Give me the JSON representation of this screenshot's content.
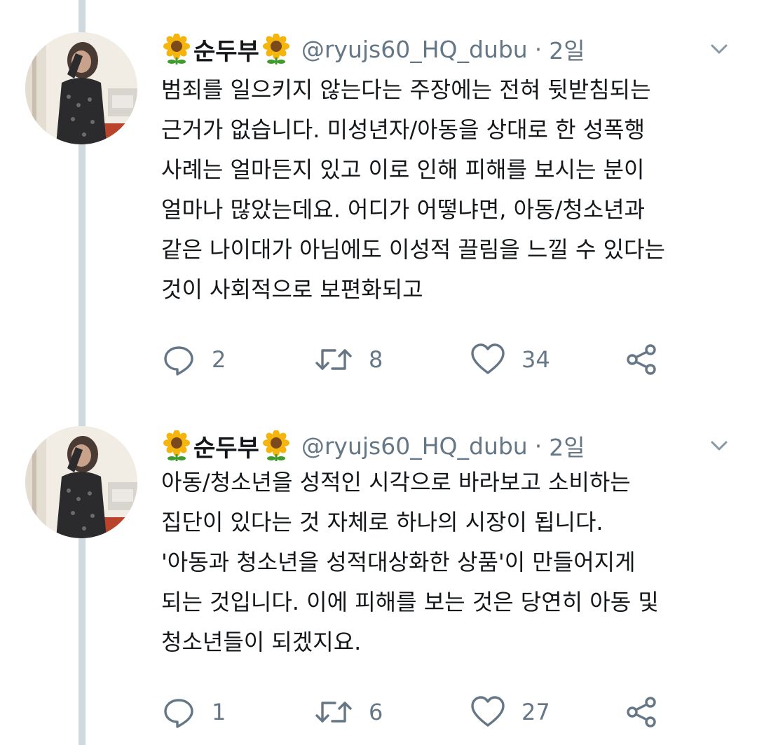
{
  "colors": {
    "text": "#14171a",
    "secondary": "#657786",
    "thread_line": "#cfd9de",
    "background": "#ffffff"
  },
  "tweets": [
    {
      "display_name": "순두부",
      "name_emoji": "sunflower",
      "handle": "@ryujs60_HQ_dubu",
      "time": "2일",
      "text": "범죄를 일으키지 않는다는 주장에는 전혀 뒷받침되는\n근거가 없습니다. 미성년자/아동을 상대로 한 성폭행\n사례는 얼마든지 있고 이로 인해 피해를 보시는 분이\n얼마나 많았는데요. 어디가 어떻냐면, 아동/청소년과\n같은 나이대가 아님에도 이성적 끌림을 느낄 수 있다는\n것이 사회적으로 보편화되고",
      "replies": "2",
      "retweets": "8",
      "likes": "34",
      "icons": [
        "reply-icon",
        "retweet-icon",
        "like-icon",
        "share-icon",
        "chevron-down-icon"
      ]
    },
    {
      "display_name": "순두부",
      "name_emoji": "sunflower",
      "handle": "@ryujs60_HQ_dubu",
      "time": "2일",
      "text": "아동/청소년을 성적인 시각으로 바라보고 소비하는\n집단이 있다는 것 자체로 하나의 시장이 됩니다.\n'아동과 청소년을 성적대상화한 상품'이 만들어지게\n되는 것입니다. 이에 피해를 보는 것은 당연히 아동 및\n청소년들이 되겠지요.",
      "replies": "1",
      "retweets": "6",
      "likes": "27",
      "icons": [
        "reply-icon",
        "retweet-icon",
        "like-icon",
        "share-icon",
        "chevron-down-icon"
      ]
    }
  ]
}
